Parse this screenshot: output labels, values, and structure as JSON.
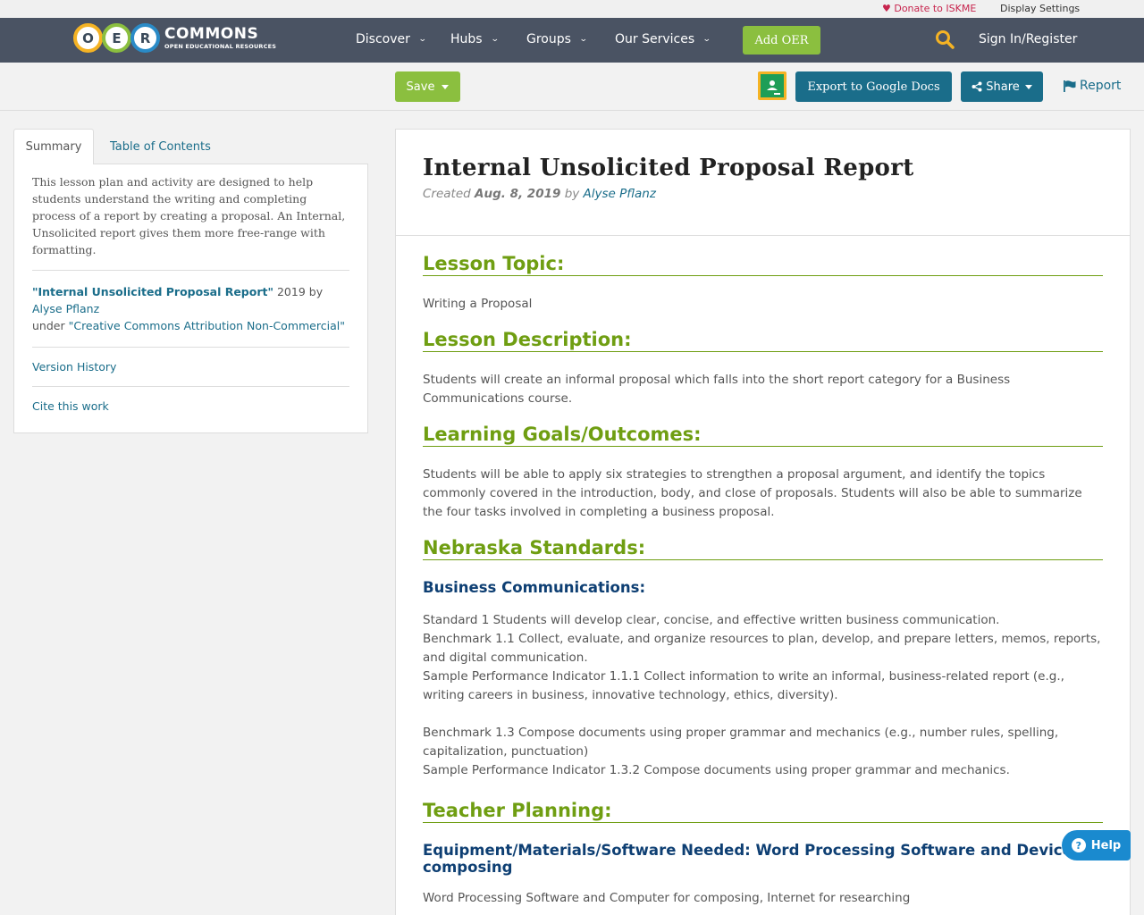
{
  "util_bar": {
    "donate": "Donate to ISKME",
    "display_settings": "Display Settings"
  },
  "logo": {
    "letters": [
      "O",
      "E",
      "R"
    ],
    "name": "COMMONS",
    "tagline": "OPEN EDUCATIONAL RESOURCES"
  },
  "nav": {
    "items": [
      "Discover",
      "Hubs",
      "Groups",
      "Our Services"
    ],
    "add_oer": "Add OER",
    "sign_in": "Sign In/Register"
  },
  "toolbar": {
    "save": "Save",
    "export": "Export to Google Docs",
    "share": "Share",
    "report": "Report"
  },
  "sidebar": {
    "tabs": [
      "Summary",
      "Table of Contents"
    ],
    "summary": "This lesson plan and activity are designed to help students understand the writing and completing process of a report by creating a proposal. An Internal, Unsolicited report gives them more free-range with formatting.",
    "credit": {
      "title": "\"Internal Unsolicited Proposal Report\"",
      "year_by": " 2019 by ",
      "author": "Alyse Pflanz",
      "under": "under ",
      "license": "\"Creative Commons Attribution Non-Commercial\""
    },
    "version_history": "Version History",
    "cite": "Cite this work"
  },
  "content": {
    "title": "Internal Unsolicited Proposal Report",
    "meta": {
      "created": "Created",
      "date": "Aug. 8, 2019",
      "by": "by",
      "author": "Alyse Pflanz"
    },
    "sections": {
      "topic_h": "Lesson Topic:",
      "topic": "Writing a Proposal",
      "desc_h": "Lesson Description:",
      "desc": "Students will create an informal proposal which falls into the short report category for a Business Communications course.",
      "goals_h": "Learning Goals/Outcomes:",
      "goals": "Students will be able to apply six strategies to strengthen a proposal argument, and identify the topics commonly covered in the introduction, body, and close of proposals. Students will also be able to summarize the four tasks involved in completing a business proposal.",
      "standards_h": "Nebraska Standards:",
      "business_h": "Business Communications:",
      "std1": "Standard 1 Students will develop clear, concise, and effective written business communication.",
      "bm11": "Benchmark 1.1 Collect, evaluate, and organize resources to plan, develop, and prepare letters, memos, reports, and digital communication.",
      "spi111": "Sample Performance Indicator 1.1.1 Collect information to write an informal, business-related report (e.g., writing careers in business, innovative technology, ethics, diversity).",
      "bm13": "Benchmark 1.3 Compose documents using proper grammar and mechanics (e.g., number rules, spelling, capitalization, punctuation)",
      "spi132": "Sample Performance Indicator 1.3.2 Compose documents using proper grammar and mechanics.",
      "planning_h": "Teacher Planning:",
      "equipment_h": "Equipment/Materials/Software Needed: Word Processing Software and Device for composing",
      "equipment": "Word Processing Software and Computer for composing, Internet for researching"
    }
  },
  "help": "Help",
  "colors": {
    "nav_bg": "#4a5363",
    "accent_green": "#8bbf3f",
    "teal": "#1a6d8a",
    "section_green": "#6f9e12",
    "subhead_blue": "#0e3f73"
  }
}
